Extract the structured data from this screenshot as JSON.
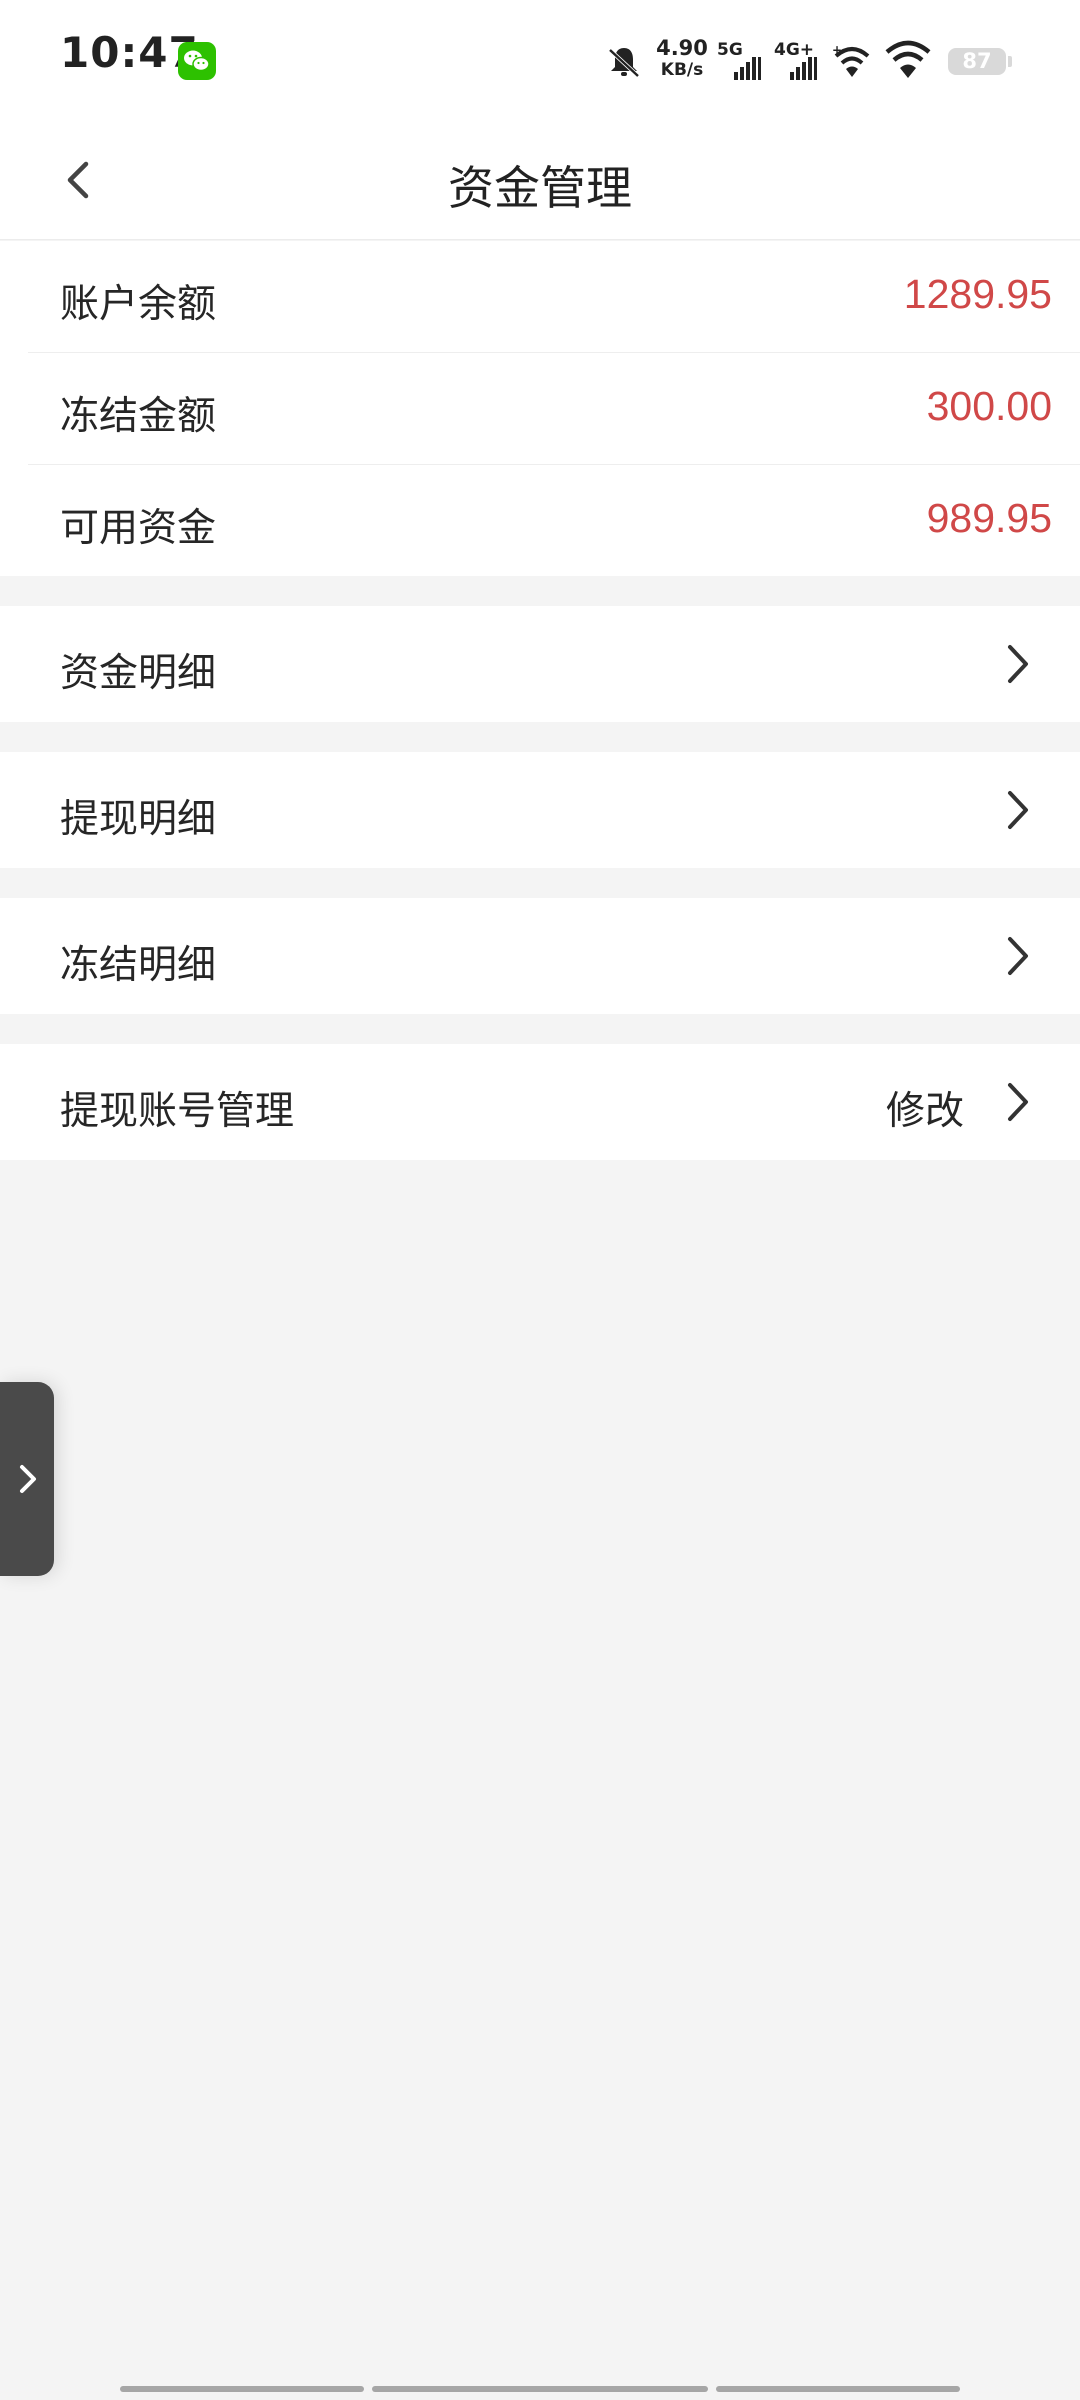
{
  "status_bar": {
    "time": "10:47",
    "net_speed_value": "4.90",
    "net_speed_unit": "KB/s",
    "sim1_label": "5G",
    "sim2_label": "4G+",
    "battery": "87",
    "app_icon": "wechat-icon",
    "accent_color": "#2dc100"
  },
  "header": {
    "title": "资金管理",
    "back_icon": "back-arrow-icon"
  },
  "balances": {
    "account_balance_label": "账户余额",
    "account_balance_value": "1289.95",
    "frozen_amount_label": "冻结金额",
    "frozen_amount_value": "300.00",
    "available_funds_label": "可用资金",
    "available_funds_value": "989.95",
    "value_color": "#d04848"
  },
  "menu": {
    "fund_details": "资金明细",
    "withdraw_details": "提现明细",
    "frozen_details": "冻结明细",
    "withdraw_account": "提现账号管理",
    "withdraw_account_action": "修改"
  },
  "side_tab": {
    "icon": "chevron-right-icon"
  }
}
